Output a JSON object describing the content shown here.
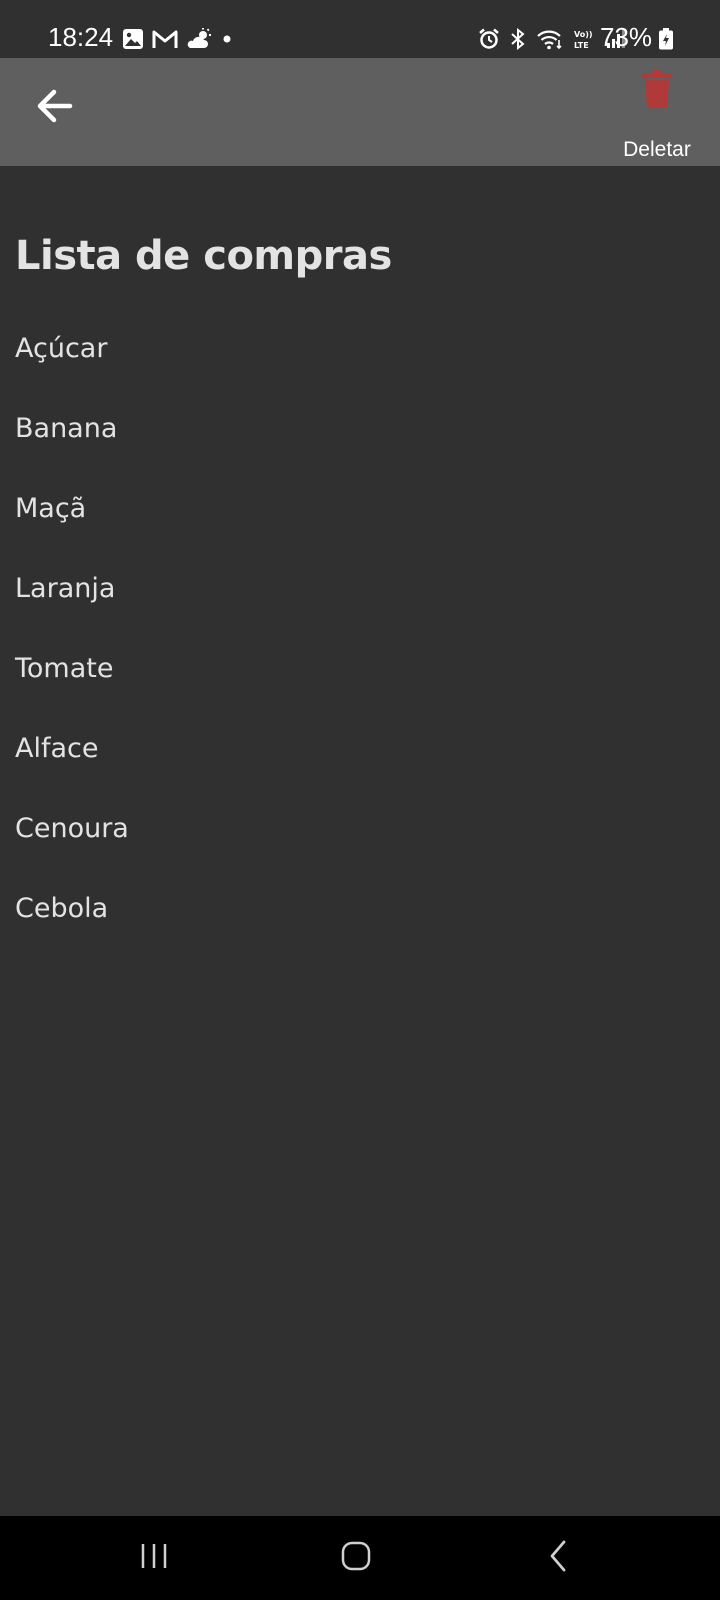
{
  "status_bar": {
    "time": "18:24",
    "battery": "73%",
    "left_icons": [
      "gallery-icon",
      "gmail-icon",
      "weather-icon",
      "dot-icon"
    ],
    "right_icons": [
      "alarm-icon",
      "bluetooth-icon",
      "wifi-icon",
      "volte-icon",
      "signal-icon",
      "battery-icon"
    ]
  },
  "app_bar": {
    "back_icon": "arrow-left-icon",
    "delete_label": "Deletar",
    "delete_icon": "trash-icon",
    "delete_icon_color": "#b03a3a",
    "background": "#5f5f5f"
  },
  "main": {
    "title": "Lista de compras",
    "items": [
      {
        "label": "Açúcar"
      },
      {
        "label": "Banana"
      },
      {
        "label": "Maçã"
      },
      {
        "label": "Laranja"
      },
      {
        "label": "Tomate"
      },
      {
        "label": "Alface"
      },
      {
        "label": "Cenoura"
      },
      {
        "label": "Cebola"
      }
    ]
  },
  "nav_bar": {
    "buttons": [
      "recent-apps-icon",
      "home-icon",
      "back-nav-icon"
    ]
  },
  "colors": {
    "background": "#303030",
    "text": "#e3e3e3",
    "accent": "#b03a3a"
  }
}
